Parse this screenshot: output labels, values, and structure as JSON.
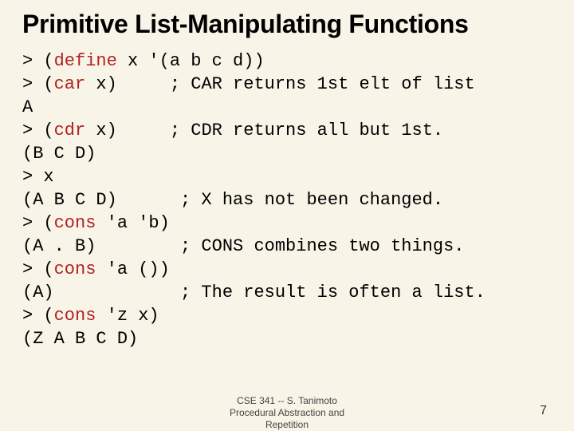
{
  "title": "Primitive List-Manipulating Functions",
  "code": {
    "l0_a": "> (",
    "l0_b": "define",
    "l0_c": " x '(a b c d))",
    "l1_a": "> (",
    "l1_b": "car",
    "l1_c": " x)     ; CAR returns 1st elt of list",
    "l2": "A",
    "l3_a": "> (",
    "l3_b": "cdr",
    "l3_c": " x)     ; CDR returns all but 1st.",
    "l4": "(B C D)",
    "l5": "> x",
    "l6": "(A B C D)      ; X has not been changed.",
    "l7_a": "> (",
    "l7_b": "cons",
    "l7_c": " 'a 'b)",
    "l8": "(A . B)        ; CONS combines two things.",
    "l9_a": "> (",
    "l9_b": "cons",
    "l9_c": " 'a ())",
    "l10": "(A)            ; The result is often a list.",
    "l11_a": "> (",
    "l11_b": "cons",
    "l11_c": " 'z x)",
    "l12": "(Z A B C D)"
  },
  "footer": {
    "line1": "CSE 341 -- S. Tanimoto",
    "line2": "Procedural Abstraction and",
    "line3": "Repetition"
  },
  "page": "7"
}
